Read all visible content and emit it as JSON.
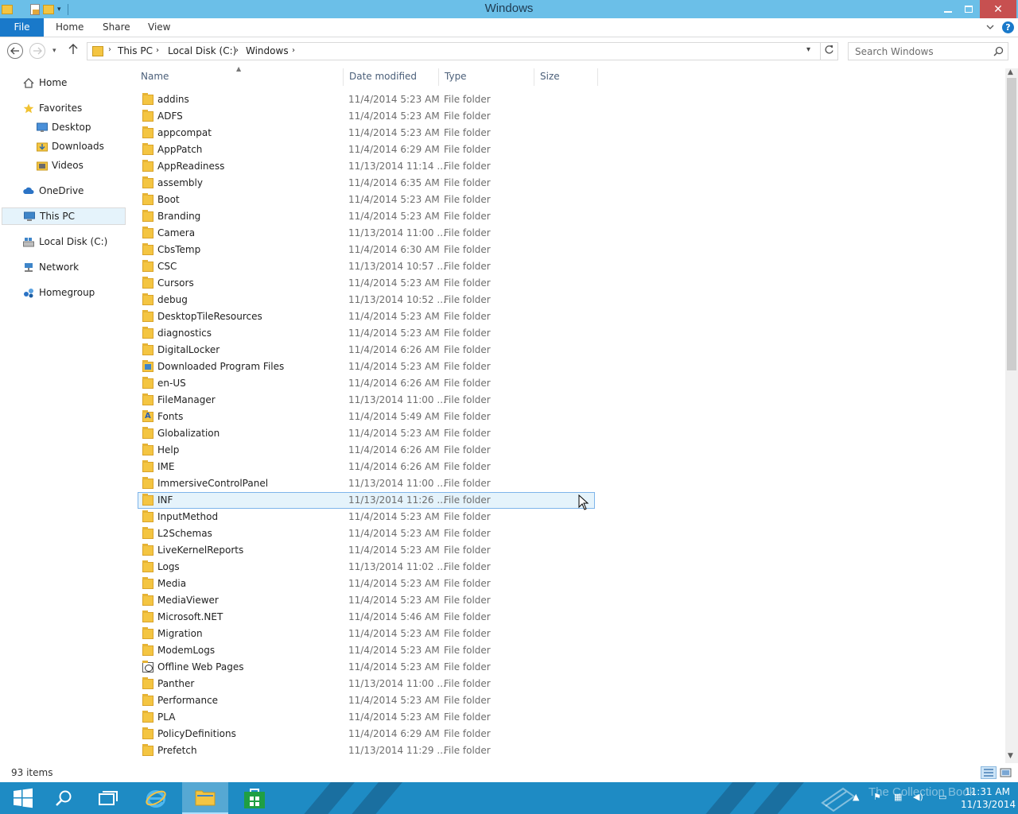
{
  "window": {
    "title": "Windows",
    "close_symbol": "✕"
  },
  "ribbon": {
    "tabs": [
      "File",
      "Home",
      "Share",
      "View"
    ],
    "help": "?"
  },
  "address": {
    "crumbs": [
      "This PC",
      "Local Disk (C:)",
      "Windows"
    ],
    "arrow": "›"
  },
  "search": {
    "placeholder": "Search Windows"
  },
  "nav": {
    "items": [
      {
        "label": "Home",
        "icon": "home-icon"
      },
      {
        "label": "Favorites",
        "icon": "star-icon"
      },
      {
        "label": "Desktop",
        "icon": "desktop-icon"
      },
      {
        "label": "Downloads",
        "icon": "downloads-icon"
      },
      {
        "label": "Videos",
        "icon": "videos-icon"
      },
      {
        "label": "OneDrive",
        "icon": "cloud-icon"
      },
      {
        "label": "This PC",
        "icon": "computer-icon"
      },
      {
        "label": "Local Disk (C:)",
        "icon": "drive-icon"
      },
      {
        "label": "Network",
        "icon": "network-icon"
      },
      {
        "label": "Homegroup",
        "icon": "homegroup-icon"
      }
    ]
  },
  "columns": {
    "name": "Name",
    "date": "Date modified",
    "type": "Type",
    "size": "Size"
  },
  "files": [
    {
      "name": "addins",
      "date": "11/4/2014 5:23 AM",
      "type": "File folder"
    },
    {
      "name": "ADFS",
      "date": "11/4/2014 5:23 AM",
      "type": "File folder"
    },
    {
      "name": "appcompat",
      "date": "11/4/2014 5:23 AM",
      "type": "File folder"
    },
    {
      "name": "AppPatch",
      "date": "11/4/2014 6:29 AM",
      "type": "File folder"
    },
    {
      "name": "AppReadiness",
      "date": "11/13/2014 11:14 ...",
      "type": "File folder"
    },
    {
      "name": "assembly",
      "date": "11/4/2014 6:35 AM",
      "type": "File folder"
    },
    {
      "name": "Boot",
      "date": "11/4/2014 5:23 AM",
      "type": "File folder"
    },
    {
      "name": "Branding",
      "date": "11/4/2014 5:23 AM",
      "type": "File folder"
    },
    {
      "name": "Camera",
      "date": "11/13/2014 11:00 ...",
      "type": "File folder"
    },
    {
      "name": "CbsTemp",
      "date": "11/4/2014 6:30 AM",
      "type": "File folder"
    },
    {
      "name": "CSC",
      "date": "11/13/2014 10:57 ...",
      "type": "File folder"
    },
    {
      "name": "Cursors",
      "date": "11/4/2014 5:23 AM",
      "type": "File folder"
    },
    {
      "name": "debug",
      "date": "11/13/2014 10:52 ...",
      "type": "File folder"
    },
    {
      "name": "DesktopTileResources",
      "date": "11/4/2014 5:23 AM",
      "type": "File folder"
    },
    {
      "name": "diagnostics",
      "date": "11/4/2014 5:23 AM",
      "type": "File folder"
    },
    {
      "name": "DigitalLocker",
      "date": "11/4/2014 6:26 AM",
      "type": "File folder"
    },
    {
      "name": "Downloaded Program Files",
      "date": "11/4/2014 5:23 AM",
      "type": "File folder",
      "icon": "dl"
    },
    {
      "name": "en-US",
      "date": "11/4/2014 6:26 AM",
      "type": "File folder"
    },
    {
      "name": "FileManager",
      "date": "11/13/2014 11:00 ...",
      "type": "File folder"
    },
    {
      "name": "Fonts",
      "date": "11/4/2014 5:49 AM",
      "type": "File folder",
      "icon": "fonts"
    },
    {
      "name": "Globalization",
      "date": "11/4/2014 5:23 AM",
      "type": "File folder"
    },
    {
      "name": "Help",
      "date": "11/4/2014 6:26 AM",
      "type": "File folder"
    },
    {
      "name": "IME",
      "date": "11/4/2014 6:26 AM",
      "type": "File folder"
    },
    {
      "name": "ImmersiveControlPanel",
      "date": "11/13/2014 11:00 ...",
      "type": "File folder"
    },
    {
      "name": "INF",
      "date": "11/13/2014 11:26 ...",
      "type": "File folder",
      "selected": true
    },
    {
      "name": "InputMethod",
      "date": "11/4/2014 5:23 AM",
      "type": "File folder"
    },
    {
      "name": "L2Schemas",
      "date": "11/4/2014 5:23 AM",
      "type": "File folder"
    },
    {
      "name": "LiveKernelReports",
      "date": "11/4/2014 5:23 AM",
      "type": "File folder"
    },
    {
      "name": "Logs",
      "date": "11/13/2014 11:02 ...",
      "type": "File folder"
    },
    {
      "name": "Media",
      "date": "11/4/2014 5:23 AM",
      "type": "File folder"
    },
    {
      "name": "MediaViewer",
      "date": "11/4/2014 5:23 AM",
      "type": "File folder"
    },
    {
      "name": "Microsoft.NET",
      "date": "11/4/2014 5:46 AM",
      "type": "File folder"
    },
    {
      "name": "Migration",
      "date": "11/4/2014 5:23 AM",
      "type": "File folder"
    },
    {
      "name": "ModemLogs",
      "date": "11/4/2014 5:23 AM",
      "type": "File folder"
    },
    {
      "name": "Offline Web Pages",
      "date": "11/4/2014 5:23 AM",
      "type": "File folder",
      "icon": "web"
    },
    {
      "name": "Panther",
      "date": "11/13/2014 11:00 ...",
      "type": "File folder"
    },
    {
      "name": "Performance",
      "date": "11/4/2014 5:23 AM",
      "type": "File folder"
    },
    {
      "name": "PLA",
      "date": "11/4/2014 5:23 AM",
      "type": "File folder"
    },
    {
      "name": "PolicyDefinitions",
      "date": "11/4/2014 6:29 AM",
      "type": "File folder"
    },
    {
      "name": "Prefetch",
      "date": "11/13/2014 11:29 ...",
      "type": "File folder"
    }
  ],
  "status": {
    "item_count": "93 items"
  },
  "taskbar": {
    "watermark": "The Collection Book",
    "time": "11:31 AM",
    "date": "11/13/2014"
  },
  "colors": {
    "titlebar": "#6bbfe8",
    "file_tab": "#1979ca",
    "selection": "#e5f3fb",
    "taskbar": "#1e8bc4"
  }
}
